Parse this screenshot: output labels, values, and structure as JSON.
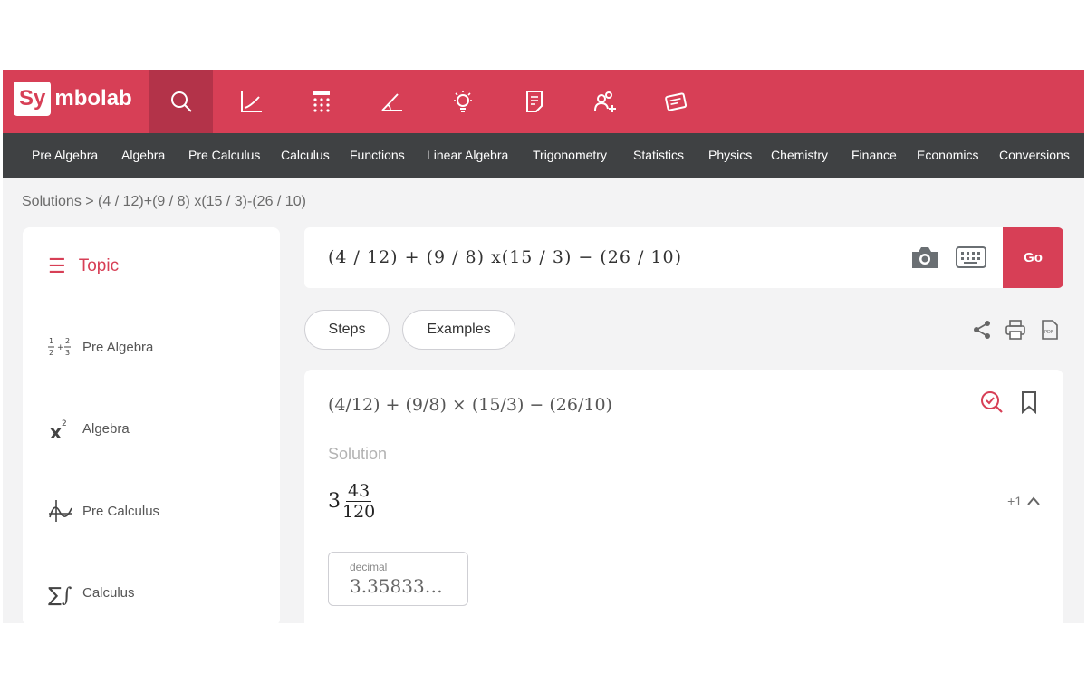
{
  "brand": {
    "logo_box": "Sy",
    "logo_rest": "mbolab"
  },
  "topbar_icons": [
    "search-icon",
    "graph-icon",
    "calculator-icon",
    "geometry-icon",
    "lightbulb-icon",
    "notebook-icon",
    "groups-icon",
    "cheat-sheet-icon"
  ],
  "subnav": [
    "Pre Algebra",
    "Algebra",
    "Pre Calculus",
    "Calculus",
    "Functions",
    "Linear Algebra",
    "Trigonometry",
    "Statistics",
    "Physics",
    "Chemistry",
    "Finance",
    "Economics",
    "Conversions"
  ],
  "breadcrumb": "Solutions > (4 / 12)+(9 / 8) x(15 / 3)-(26 / 10)",
  "sidebar": {
    "heading": "Topic",
    "items": [
      {
        "label": "Pre Algebra",
        "icon": "fraction-icon"
      },
      {
        "label": "Algebra",
        "icon": "x-squared-icon"
      },
      {
        "label": "Pre Calculus",
        "icon": "function-graph-icon"
      },
      {
        "label": "Calculus",
        "icon": "sigma-integral-icon"
      }
    ]
  },
  "input": {
    "expression": "(4 / 12)  +  (9 / 8) x(15 / 3)  −  (26 / 10)",
    "go_label": "Go"
  },
  "tabs": {
    "steps": "Steps",
    "examples": "Examples"
  },
  "solution": {
    "problem": "(4/12) + (9/8) × (15/3) − (26/10)",
    "label": "Solution",
    "whole": "3",
    "numerator": "43",
    "denominator": "120",
    "more": "+1",
    "decimal_label": "decimal",
    "decimal_value": "3.35833…"
  },
  "colors": {
    "brand": "#d73f56",
    "brand_dark": "#b33349",
    "subnav": "#3f4143"
  }
}
